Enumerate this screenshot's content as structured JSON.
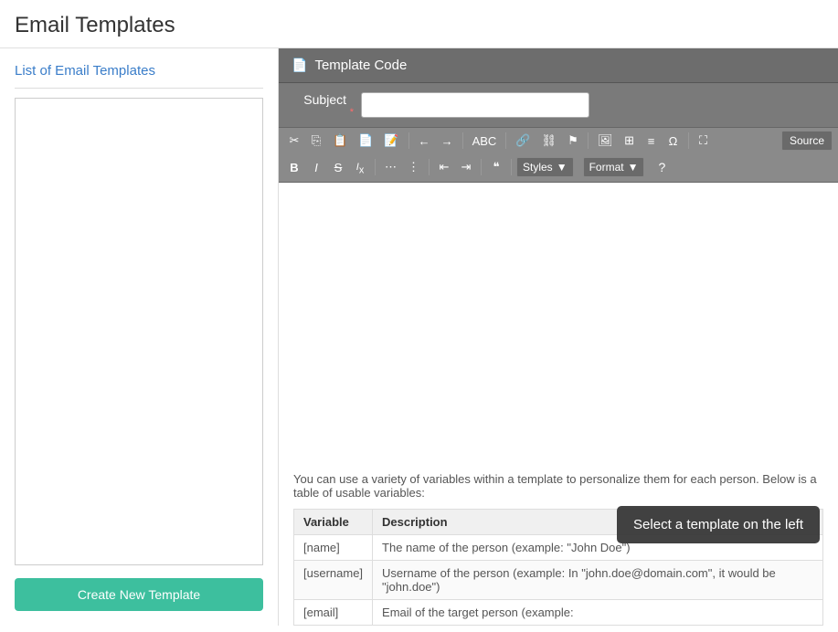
{
  "page": {
    "title": "Email Templates"
  },
  "sidebar": {
    "title": "List of Email Templates",
    "create_button": "Create New Template"
  },
  "right_panel": {
    "header": "Template Code",
    "subject_label": "Subject",
    "subject_required": "*",
    "subject_placeholder": "",
    "source_label": "Source",
    "format_label": "Format",
    "styles_label": "Styles",
    "help_label": "?",
    "toolbar_row1": [
      {
        "icon": "✂",
        "name": "cut-icon"
      },
      {
        "icon": "⎘",
        "name": "copy-icon"
      },
      {
        "icon": "⎗",
        "name": "paste-icon"
      },
      {
        "icon": "⎙",
        "name": "paste-text-icon"
      },
      {
        "icon": "⊞",
        "name": "paste-from-word-icon"
      },
      {
        "icon": "←",
        "name": "undo-icon"
      },
      {
        "icon": "→",
        "name": "redo-icon"
      },
      {
        "icon": "ABC",
        "name": "spellcheck-icon"
      },
      {
        "icon": "⛓",
        "name": "link-icon"
      },
      {
        "icon": "⛓‍",
        "name": "unlink-icon"
      },
      {
        "icon": "⚑",
        "name": "anchor-icon"
      },
      {
        "icon": "▦",
        "name": "image-icon"
      },
      {
        "icon": "⊞",
        "name": "table-icon"
      },
      {
        "icon": "≡",
        "name": "horizontal-rule-icon"
      },
      {
        "icon": "Ω",
        "name": "special-char-icon"
      },
      {
        "icon": "⛶",
        "name": "maximize-icon"
      }
    ],
    "toolbar_row2": [
      {
        "icon": "B",
        "name": "bold-icon",
        "bold": true
      },
      {
        "icon": "I",
        "name": "italic-icon",
        "italic": true
      },
      {
        "icon": "S",
        "name": "strikethrough-icon"
      },
      {
        "icon": "Ix",
        "name": "remove-format-icon"
      },
      {
        "icon": "≡",
        "name": "ordered-list-icon"
      },
      {
        "icon": "≡",
        "name": "unordered-list-icon"
      },
      {
        "icon": "⇤",
        "name": "outdent-icon"
      },
      {
        "icon": "⇥",
        "name": "indent-icon"
      },
      {
        "icon": "❞",
        "name": "blockquote-icon"
      }
    ],
    "info_text": "You can use a variety of variables within a template to personalize them for each person. Below is a table of usable variables:",
    "tooltip_text": "Select a template on the left",
    "variables_table": {
      "headers": [
        "Variable",
        "Description"
      ],
      "rows": [
        {
          "variable": "[name]",
          "description": "The name of the person (example: \"John Doe\")"
        },
        {
          "variable": "[username]",
          "description": "Username of the person (example: In \"john.doe@domain.com\", it would be \"john.doe\")"
        },
        {
          "variable": "[email]",
          "description": "Email of the target person (example:"
        }
      ]
    }
  }
}
